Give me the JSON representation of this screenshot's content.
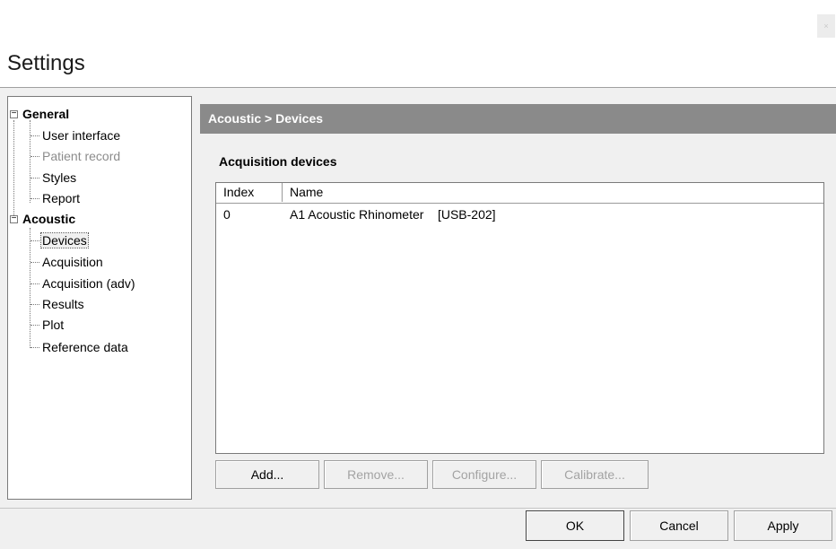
{
  "window": {
    "title": "Settings",
    "close_glyph": "×"
  },
  "tree": {
    "collapse_glyph": "−",
    "groups": [
      {
        "label": "General",
        "children": [
          {
            "label": "User interface",
            "enabled": true
          },
          {
            "label": "Patient record",
            "enabled": false
          },
          {
            "label": "Styles",
            "enabled": true
          },
          {
            "label": "Report",
            "enabled": true
          }
        ]
      },
      {
        "label": "Acoustic",
        "children": [
          {
            "label": "Devices",
            "enabled": true,
            "selected": true
          },
          {
            "label": "Acquisition",
            "enabled": true
          },
          {
            "label": "Acquisition (adv)",
            "enabled": true
          },
          {
            "label": "Results",
            "enabled": true
          },
          {
            "label": "Plot",
            "enabled": true
          },
          {
            "label": "Reference data",
            "enabled": true
          }
        ]
      }
    ]
  },
  "panel": {
    "breadcrumb": "Acoustic > Devices",
    "group_label": "Acquisition devices",
    "list": {
      "columns": [
        "Index",
        "Name"
      ],
      "rows": [
        {
          "index": "0",
          "name": "A1 Acoustic Rhinometer    [USB-202]"
        }
      ]
    },
    "buttons": {
      "add": "Add...",
      "remove": "Remove...",
      "configure": "Configure...",
      "calibrate": "Calibrate..."
    }
  },
  "dialog_buttons": {
    "ok": "OK",
    "cancel": "Cancel",
    "apply": "Apply"
  },
  "colors": {
    "section_header_bg": "#8a8a8a",
    "disabled_text": "#8c8c8c"
  }
}
